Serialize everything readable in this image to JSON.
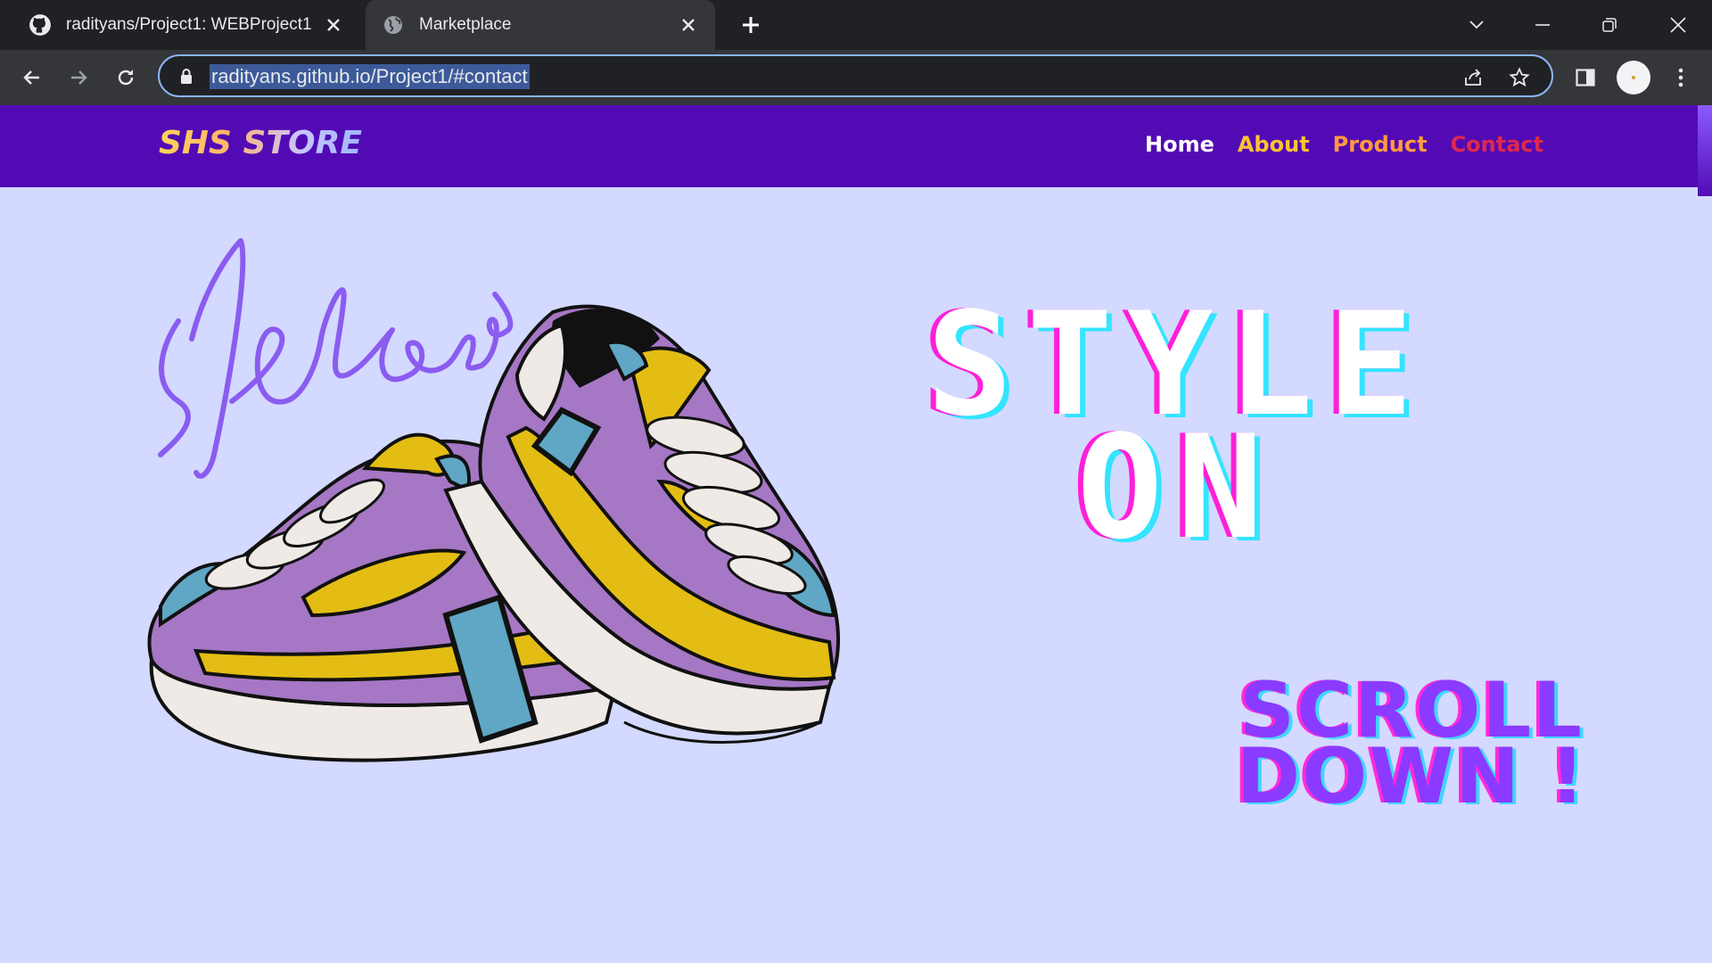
{
  "browser": {
    "tabs": [
      {
        "title": "radityans/Project1: WEBProject1",
        "icon": "github-icon",
        "active": false
      },
      {
        "title": "Marketplace",
        "icon": "globe-icon",
        "active": true
      }
    ],
    "url": "radityans.github.io/Project1/#contact"
  },
  "site": {
    "brand": "SHS STORE",
    "nav": [
      {
        "label": "Home",
        "color": "#ffffff"
      },
      {
        "label": "About",
        "color": "#ffc233"
      },
      {
        "label": "Product",
        "color": "#ff9a3d"
      },
      {
        "label": "Contact",
        "color": "#e0284d"
      }
    ],
    "hero": {
      "headline_line1": "STYLE",
      "headline_line2": "ON",
      "scroll_line1": "SCROLL",
      "scroll_line2": "DOWN !",
      "signature": "slebew"
    }
  },
  "colors": {
    "nav_bg": "#520bb4",
    "page_bg": "#d4d9ff",
    "accent_magenta": "#ff1fd8",
    "accent_cyan": "#34e4ff",
    "scroll_purple": "#8a3bff"
  }
}
